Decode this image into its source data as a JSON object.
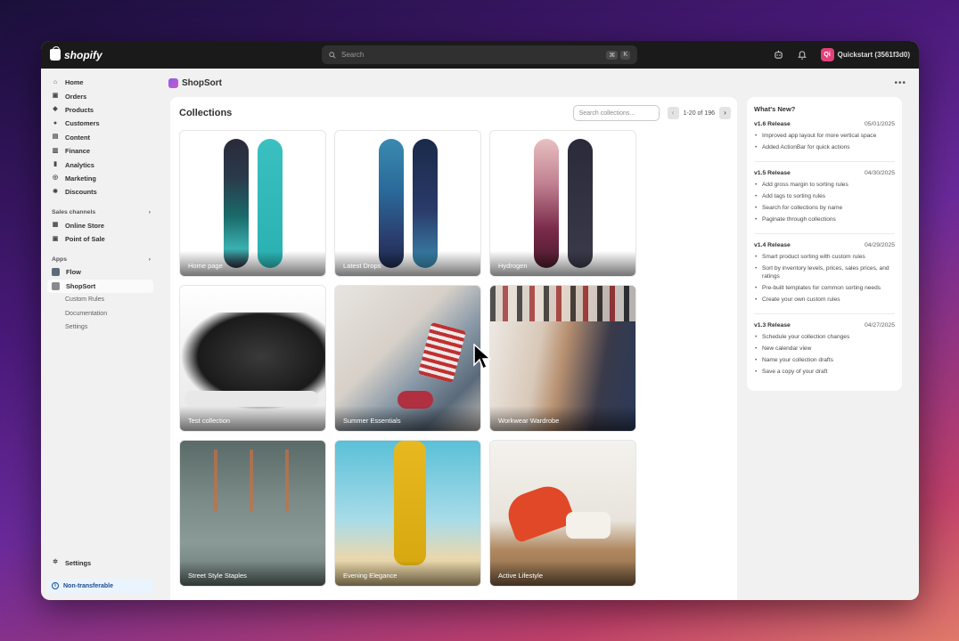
{
  "topbar": {
    "brand": "shopify",
    "search_placeholder": "Search",
    "shortcut_keys": [
      "⌘",
      "K"
    ],
    "store_initials": "Qi",
    "store_name": "Quickstart (3561f3d0)"
  },
  "sidebar": {
    "items": [
      {
        "label": "Home",
        "icon": "home-icon"
      },
      {
        "label": "Orders",
        "icon": "orders-icon"
      },
      {
        "label": "Products",
        "icon": "tag-icon"
      },
      {
        "label": "Customers",
        "icon": "person-icon"
      },
      {
        "label": "Content",
        "icon": "content-icon"
      },
      {
        "label": "Finance",
        "icon": "bank-icon"
      },
      {
        "label": "Analytics",
        "icon": "chart-icon"
      },
      {
        "label": "Marketing",
        "icon": "target-icon"
      },
      {
        "label": "Discounts",
        "icon": "discount-icon"
      }
    ],
    "sales_channels_label": "Sales channels",
    "sales_channels": [
      {
        "label": "Online Store",
        "icon": "store-icon"
      },
      {
        "label": "Point of Sale",
        "icon": "pos-icon"
      }
    ],
    "apps_label": "Apps",
    "apps": [
      {
        "label": "Flow",
        "icon": "flow-icon"
      },
      {
        "label": "ShopSort",
        "icon": "shopsort-icon"
      }
    ],
    "app_subitems": [
      "Custom Rules",
      "Documentation",
      "Settings"
    ],
    "settings_label": "Settings",
    "non_transferable_label": "Non-transferable"
  },
  "app": {
    "name": "ShopSort"
  },
  "collections": {
    "title": "Collections",
    "search_placeholder": "Search collections...",
    "pagination": "1-20 of 196",
    "items": [
      {
        "name": "Home page"
      },
      {
        "name": "Latest Drops"
      },
      {
        "name": "Hydrogen"
      },
      {
        "name": "Test collection"
      },
      {
        "name": "Summer Essentials"
      },
      {
        "name": "Workwear Wardrobe"
      },
      {
        "name": "Street Style Staples"
      },
      {
        "name": "Evening Elegance"
      },
      {
        "name": "Active Lifestyle"
      }
    ]
  },
  "whats_new": {
    "title": "What's New?",
    "releases": [
      {
        "version": "v1.6 Release",
        "date": "05/01/2025",
        "notes": [
          "Improved app layout for more vertical space",
          "Added ActionBar for quick actions"
        ]
      },
      {
        "version": "v1.5 Release",
        "date": "04/30/2025",
        "notes": [
          "Add gross margin to sorting rules",
          "Add tags to sorting rules",
          "Search for collections by name",
          "Paginate through collections"
        ]
      },
      {
        "version": "v1.4 Release",
        "date": "04/29/2025",
        "notes": [
          "Smart product sorting with custom rules",
          "Sort by inventory levels, prices, sales prices, and ratings",
          "Pre-built templates for common sorting needs",
          "Create your own custom rules"
        ]
      },
      {
        "version": "v1.3 Release",
        "date": "04/27/2025",
        "notes": [
          "Schedule your collection changes",
          "New calendar view",
          "Name your collection drafts",
          "Save a copy of your draft"
        ]
      }
    ]
  }
}
